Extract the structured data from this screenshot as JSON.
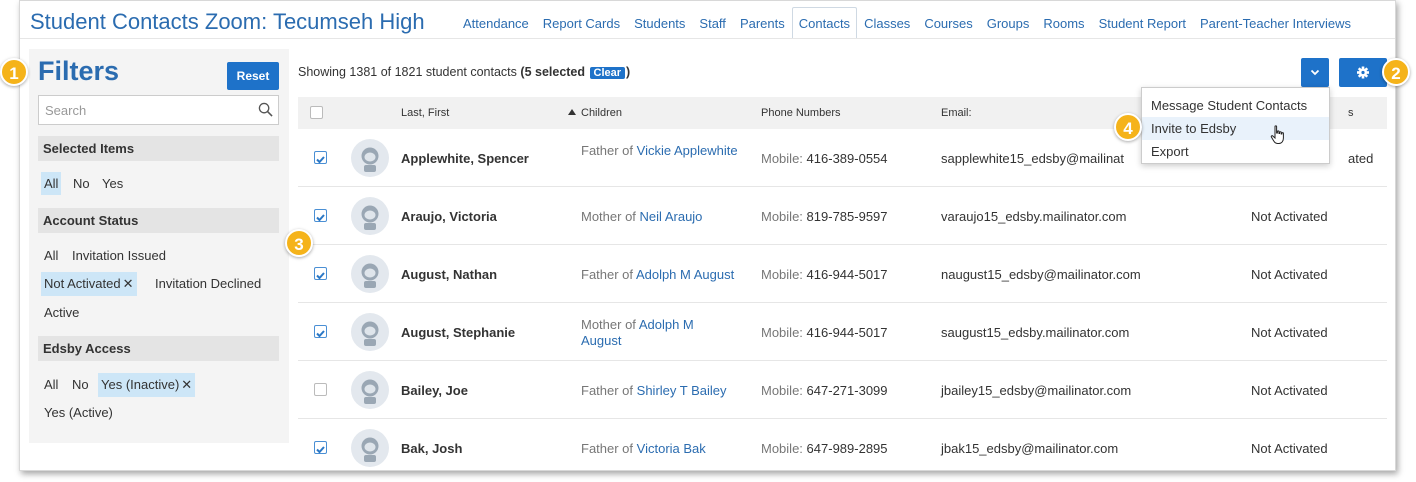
{
  "header": {
    "title": "Student Contacts Zoom: Tecumseh High",
    "tabs": [
      {
        "label": "Attendance",
        "active": false
      },
      {
        "label": "Report Cards",
        "active": false
      },
      {
        "label": "Students",
        "active": false
      },
      {
        "label": "Staff",
        "active": false
      },
      {
        "label": "Parents",
        "active": false
      },
      {
        "label": "Contacts",
        "active": true
      },
      {
        "label": "Classes",
        "active": false
      },
      {
        "label": "Courses",
        "active": false
      },
      {
        "label": "Groups",
        "active": false
      },
      {
        "label": "Rooms",
        "active": false
      },
      {
        "label": "Student Report",
        "active": false
      },
      {
        "label": "Parent-Teacher Interviews",
        "active": false
      }
    ]
  },
  "sidebar": {
    "title": "Filters",
    "reset_label": "Reset",
    "search_placeholder": "Search",
    "search_value": "",
    "selected_items": {
      "heading": "Selected Items",
      "options": [
        {
          "label": "All",
          "selected": true
        },
        {
          "label": "No",
          "selected": false
        },
        {
          "label": "Yes",
          "selected": false
        }
      ]
    },
    "account_status": {
      "heading": "Account Status",
      "options": [
        {
          "label": "All",
          "selected": false
        },
        {
          "label": "Invitation Issued",
          "selected": false
        },
        {
          "label": "Not Activated",
          "selected": true
        },
        {
          "label": "Invitation Declined",
          "selected": false
        },
        {
          "label": "Active",
          "selected": false
        }
      ]
    },
    "edsby_access": {
      "heading": "Edsby Access",
      "options": [
        {
          "label": "All",
          "selected": false
        },
        {
          "label": "No",
          "selected": false
        },
        {
          "label": "Yes (Inactive)",
          "selected": true
        },
        {
          "label": "Yes (Active)",
          "selected": false
        }
      ]
    },
    "remove_glyph": "✕"
  },
  "summary": {
    "prefix": "Showing 1381 of 1821 student contacts",
    "selected_text": "(5 selected",
    "clear_label": "Clear",
    "suffix": ")"
  },
  "table": {
    "columns": {
      "name": "Last, First",
      "children": "Children",
      "phone": "Phone Numbers",
      "email": "Email:",
      "status": "s"
    },
    "rows": [
      {
        "checked": true,
        "name": "Applewhite, Spencer",
        "relation": "Father of",
        "child": "Vickie Applewhite",
        "phone_label": "Mobile:",
        "phone": "416-389-0554",
        "email": "sapplewhite15_edsby@mailinat",
        "status": "ated"
      },
      {
        "checked": true,
        "name": "Araujo, Victoria",
        "relation": "Mother of",
        "child": "Neil Araujo",
        "phone_label": "Mobile:",
        "phone": "819-785-9597",
        "email": "varaujo15_edsby.mailinator.com",
        "status": "Not Activated"
      },
      {
        "checked": true,
        "name": "August, Nathan",
        "relation": "Father of",
        "child": "Adolph M August",
        "phone_label": "Mobile:",
        "phone": "416-944-5017",
        "email": "naugust15_edsby@mailinator.com",
        "status": "Not Activated"
      },
      {
        "checked": true,
        "name": "August, Stephanie",
        "relation": "Mother of",
        "child": "Adolph M August",
        "phone_label": "Mobile:",
        "phone": "416-944-5017",
        "email": "saugust15_edsby.mailinator.com",
        "status": "Not Activated"
      },
      {
        "checked": false,
        "name": "Bailey, Joe",
        "relation": "Father of",
        "child": "Shirley T Bailey",
        "phone_label": "Mobile:",
        "phone": "647-271-3099",
        "email": "jbailey15_edsby@mailinator.com",
        "status": "Not Activated"
      },
      {
        "checked": true,
        "name": "Bak, Josh",
        "relation": "Father of",
        "child": "Victoria Bak",
        "phone_label": "Mobile:",
        "phone": "647-989-2895",
        "email": "jbak15_edsby@mailinator.com",
        "status": "Not Activated"
      }
    ]
  },
  "menu": {
    "items": [
      {
        "label": "Message Student Contacts",
        "hover": false
      },
      {
        "label": "Invite to Edsby",
        "hover": true
      },
      {
        "label": "Export",
        "hover": false
      }
    ]
  },
  "badges": [
    "1",
    "2",
    "3",
    "4"
  ],
  "colors": {
    "accent": "#1e72c9",
    "link": "#2b6cb0",
    "selected_chip": "#cde6f7",
    "badge": "#f5b31a"
  }
}
